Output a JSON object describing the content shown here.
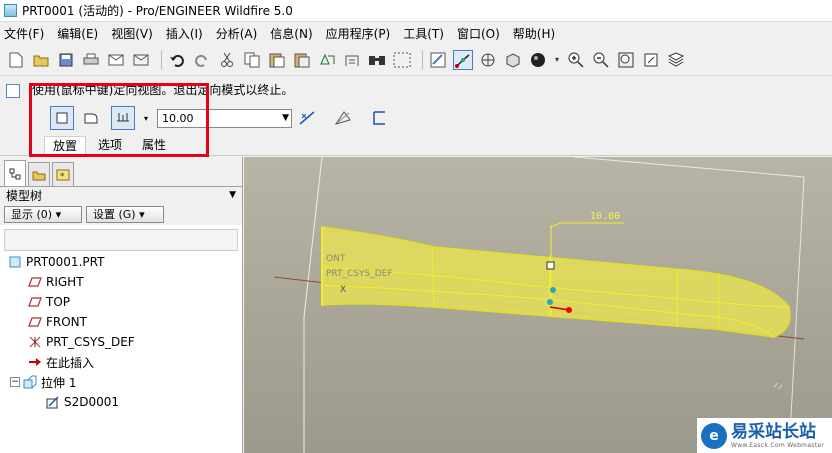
{
  "window": {
    "title": "PRT0001 (活动的) - Pro/ENGINEER Wildfire 5.0"
  },
  "menu": [
    "文件(F)",
    "编辑(E)",
    "视图(V)",
    "插入(I)",
    "分析(A)",
    "信息(N)",
    "应用程序(P)",
    "工具(T)",
    "窗口(O)",
    "帮助(H)"
  ],
  "message": "使用(鼠标中键)定向视图。退出定向模式以终止。",
  "dashboard": {
    "depth_value": "10.00",
    "tabs": [
      "放置",
      "选项",
      "属性"
    ]
  },
  "model_tree": {
    "title": "模型树",
    "show_btn": "显示 (0) ▾",
    "settings_btn": "设置 (G) ▾",
    "items": [
      {
        "label": "PRT0001.PRT",
        "icon": "part-icon"
      },
      {
        "label": "RIGHT",
        "icon": "datum-plane-icon"
      },
      {
        "label": "TOP",
        "icon": "datum-plane-icon"
      },
      {
        "label": "FRONT",
        "icon": "datum-plane-icon"
      },
      {
        "label": "PRT_CSYS_DEF",
        "icon": "csys-icon"
      },
      {
        "label": "在此插入",
        "icon": "insert-here-arrow-icon"
      },
      {
        "label": "拉伸 1",
        "icon": "extrude-icon"
      },
      {
        "label": "S2D0001",
        "icon": "sketch-icon"
      }
    ]
  },
  "viewport": {
    "dim_label": "10.00",
    "csys_label1": "ONT",
    "csys_label2": "PRT_CSYS_DEF",
    "axis_mark": "X",
    "part_color": "#e4e05a",
    "bg_color": "#a8a596"
  },
  "watermark": {
    "text": "易采站长站",
    "sub": "Www.Easck.Com Webmaster"
  },
  "colors": {
    "highlight_box": "#e2001a",
    "accent": "#4a7ebb"
  }
}
